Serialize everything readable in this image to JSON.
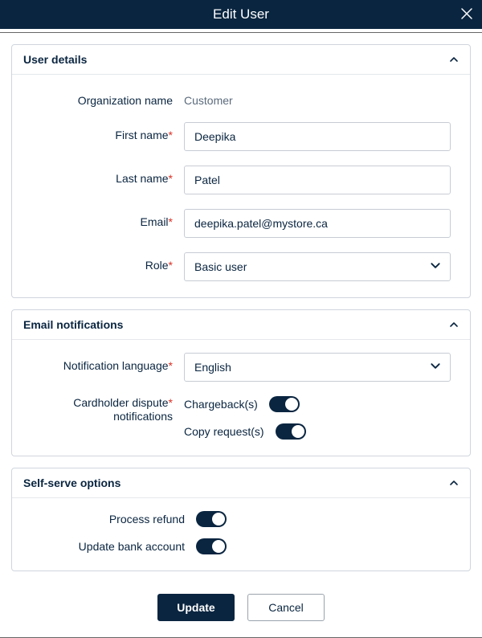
{
  "header": {
    "title": "Edit User"
  },
  "sections": {
    "user_details": {
      "title": "User details",
      "org_label": "Organization name",
      "org_value": "Customer",
      "first_name_label": "First name",
      "first_name_value": "Deepika",
      "last_name_label": "Last name",
      "last_name_value": "Patel",
      "email_label": "Email",
      "email_value": "deepika.patel@mystore.ca",
      "role_label": "Role",
      "role_value": "Basic user"
    },
    "email_notifications": {
      "title": "Email notifications",
      "language_label": "Notification language",
      "language_value": "English",
      "dispute_label_line1": "Cardholder dispute",
      "required_star": "*",
      "dispute_label_line2": "notifications",
      "toggle1_label": "Chargeback(s)",
      "toggle2_label": "Copy request(s)"
    },
    "self_serve": {
      "title": "Self-serve options",
      "refund_label": "Process refund",
      "bank_label": "Update bank account"
    }
  },
  "footer": {
    "update": "Update",
    "cancel": "Cancel"
  }
}
